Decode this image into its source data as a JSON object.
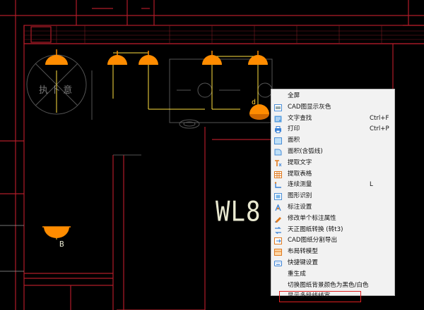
{
  "drawing": {
    "big_label": "WL8",
    "fixture_label_b": "B",
    "fixture_label_d": "d",
    "faded_text": "执 卜 意"
  },
  "context_menu": {
    "items": [
      {
        "label": "全屏",
        "icon": "none",
        "shortcut": ""
      },
      {
        "label": "CAD图显示灰色",
        "icon": "gray-display-icon",
        "shortcut": ""
      },
      {
        "label": "文字查找",
        "icon": "text-search-icon",
        "shortcut": "Ctrl+F"
      },
      {
        "label": "打印",
        "icon": "print-icon",
        "shortcut": "Ctrl+P"
      },
      {
        "label": "面积",
        "icon": "area-icon",
        "shortcut": ""
      },
      {
        "label": "面积(含弧线)",
        "icon": "area-arc-icon",
        "shortcut": ""
      },
      {
        "label": "提取文字",
        "icon": "extract-text-icon",
        "shortcut": ""
      },
      {
        "label": "提取表格",
        "icon": "extract-table-icon",
        "shortcut": ""
      },
      {
        "label": "连续测量",
        "icon": "measure-icon",
        "shortcut": "L"
      },
      {
        "label": "图形识别",
        "icon": "shape-recognition-icon",
        "shortcut": ""
      },
      {
        "label": "标注设置",
        "icon": "annotation-settings-icon",
        "shortcut": ""
      },
      {
        "label": "修改单个标注属性",
        "icon": "edit-annotation-icon",
        "shortcut": ""
      },
      {
        "label": "天正图纸转换 (转t3)",
        "icon": "tangent-convert-icon",
        "shortcut": ""
      },
      {
        "label": "CAD图纸分割导出",
        "icon": "split-export-icon",
        "shortcut": ""
      },
      {
        "label": "布局转模型",
        "icon": "layout-to-model-icon",
        "shortcut": ""
      },
      {
        "label": "快捷键设置",
        "icon": "shortcut-settings-icon",
        "shortcut": ""
      },
      {
        "label": "重生成",
        "icon": "none",
        "shortcut": ""
      },
      {
        "label": "切换图纸背景颜色为黑色/白色",
        "icon": "none",
        "shortcut": ""
      },
      {
        "label": "显示多段线线宽",
        "icon": "none",
        "shortcut": ""
      }
    ]
  },
  "colors": {
    "fixture": "#ff8c00",
    "wall": "#c0202a",
    "wire": "#ffe040",
    "menu_bg": "#f2f2f2",
    "highlight_border": "#e02020"
  }
}
